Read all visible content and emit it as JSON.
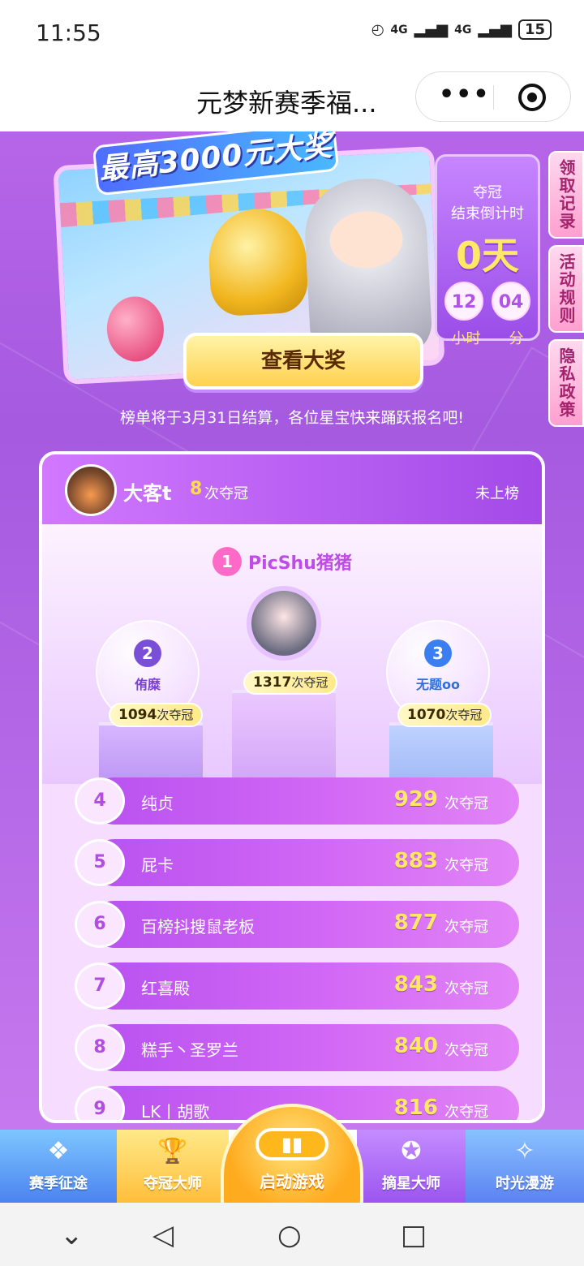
{
  "status_bar": {
    "time": "11:55",
    "signal1": "4G",
    "signal2": "4G",
    "battery": "15"
  },
  "header": {
    "title": "元梦新赛季福...",
    "more_label": "•••"
  },
  "banner": {
    "prize_text": "最高3000元大奖",
    "view_button": "查看大奖"
  },
  "countdown": {
    "line1": "夺冠",
    "line2": "结束倒计时",
    "days": "0天",
    "hours": "12",
    "minutes": "04",
    "hours_unit": "小时",
    "minutes_unit": "分"
  },
  "side_tabs": [
    "领取记录",
    "活动规则",
    "隐私政策"
  ],
  "notice": "榜单将于3月31日结算，各位星宝快来踊跃报名吧!",
  "my_rank": {
    "name": "大客t",
    "count": "8",
    "unit": "次夺冠",
    "status": "未上榜"
  },
  "top3": [
    {
      "rank": "1",
      "name": "PicShu猪猪",
      "count": "1317",
      "unit": "次夺冠"
    },
    {
      "rank": "2",
      "name": "侑糜",
      "count": "1094",
      "unit": "次夺冠"
    },
    {
      "rank": "3",
      "name": "无题oo",
      "count": "1070",
      "unit": "次夺冠"
    }
  ],
  "rows": [
    {
      "rank": "4",
      "name": "纯贞",
      "count": "929",
      "unit": "次夺冠"
    },
    {
      "rank": "5",
      "name": "屁卡",
      "count": "883",
      "unit": "次夺冠"
    },
    {
      "rank": "6",
      "name": "百榜抖搜鼠老板",
      "count": "877",
      "unit": "次夺冠"
    },
    {
      "rank": "7",
      "name": "红喜殿",
      "count": "843",
      "unit": "次夺冠"
    },
    {
      "rank": "8",
      "name": "糕手丶圣罗兰",
      "count": "840",
      "unit": "次夺冠"
    },
    {
      "rank": "9",
      "name": "LK丨胡歌",
      "count": "816",
      "unit": "次夺冠"
    }
  ],
  "bottom_nav": {
    "season": "赛季征途",
    "champion": "夺冠大师",
    "launch": "启动游戏",
    "star": "摘星大师",
    "travel": "时光漫游"
  },
  "colors": {
    "accent": "#b25fe0",
    "gold": "#ffe866"
  }
}
